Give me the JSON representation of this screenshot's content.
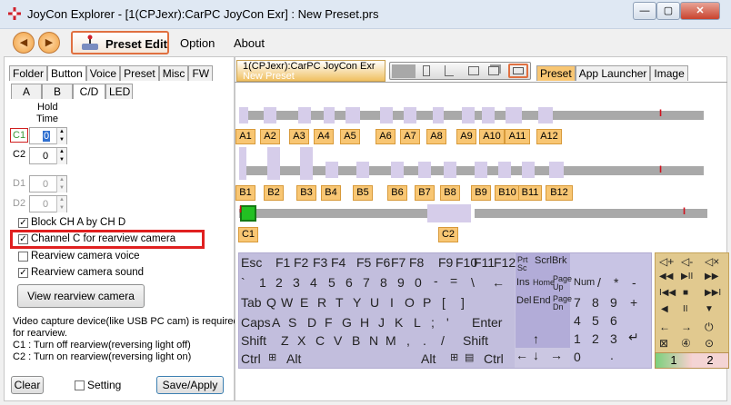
{
  "window": {
    "title": "JoyCon Explorer - [1(CPJexr):CarPC JoyCon Exr] : New Preset.prs",
    "min": "—",
    "max": "▢",
    "close": "✕"
  },
  "menu": {
    "back": "◀",
    "forward": "▶",
    "preset_edit": "Preset Edit",
    "option": "Option",
    "about": "About"
  },
  "left": {
    "tabs": [
      "Folder",
      "Button",
      "Voice",
      "Preset",
      "Misc",
      "FW"
    ],
    "subtabs": [
      "A",
      "B",
      "C/D",
      "LED"
    ],
    "hold_time": [
      "Hold",
      "Time"
    ],
    "rows": [
      {
        "label": "C1",
        "value": "0"
      },
      {
        "label": "C2",
        "value": "0"
      },
      {
        "label": "D1",
        "value": "0"
      },
      {
        "label": "D2",
        "value": "0"
      }
    ],
    "checks": [
      {
        "label": "Block CH A by CH D",
        "checked": true
      },
      {
        "label": "Channel C for rearview camera",
        "checked": true
      },
      {
        "label": "Rearview camera voice",
        "checked": false
      },
      {
        "label": "Rearview camera sound",
        "checked": true
      }
    ],
    "view_button": "View rearview camera",
    "info": [
      "Video capture device(like USB PC cam) is required",
      "for rearview.",
      "C1 : Turn off rearview(reversing light off)",
      "C2 : Turn on rearview(reversing light on)"
    ],
    "clear": "Clear",
    "setting": "Setting",
    "save": "Save/Apply"
  },
  "right": {
    "device_tab": "1(CPJexr):CarPC JoyCon Exr",
    "device_sub": "New Preset",
    "view_tabs": [
      "Preset",
      "App Launcher",
      "Image"
    ],
    "a_channels": [
      "A1",
      "A2",
      "A3",
      "A4",
      "A5",
      "A6",
      "A7",
      "A8",
      "A9",
      "A10",
      "A11",
      "A12"
    ],
    "b_channels": [
      "B1",
      "B2",
      "B3",
      "B4",
      "B5",
      "B6",
      "B7",
      "B8",
      "B9",
      "B10",
      "B11",
      "B12"
    ],
    "c_channels": [
      "C1",
      "C2"
    ]
  },
  "keyboard": {
    "fn": [
      "Esc",
      "F1",
      "F2",
      "F3",
      "F4",
      "F5",
      "F6",
      "F7",
      "F8",
      "F9",
      "F10",
      "F11",
      "F12",
      "Prt",
      "Sc",
      "ScrlBrk"
    ],
    "num": [
      "`",
      "1",
      "2",
      "3",
      "4",
      "5",
      "6",
      "7",
      "8",
      "9",
      "0",
      "-",
      "=",
      "\\",
      "←"
    ],
    "qrow": [
      "Tab",
      "Q",
      "W",
      "E",
      "R",
      "T",
      "Y",
      "U",
      "I",
      "O",
      "P",
      "[",
      "]"
    ],
    "arow": [
      "Caps",
      "A",
      "S",
      "D",
      "F",
      "G",
      "H",
      "J",
      "K",
      "L",
      ";",
      "'",
      "Enter"
    ],
    "zrow": [
      "Shift",
      "Z",
      "X",
      "C",
      "V",
      "B",
      "N",
      "M",
      ",",
      ".",
      "/",
      "Shift"
    ],
    "brow": [
      "Ctrl",
      "Alt",
      "Alt",
      "Ctrl"
    ],
    "nav": [
      "Ins",
      "Home",
      "Page Up",
      "Del",
      "End",
      "Page Dn",
      "↑",
      "←",
      "↓",
      "→"
    ],
    "pad": [
      "Num",
      "/",
      "*",
      "-",
      "7",
      "8",
      "9",
      "+",
      "4",
      "5",
      "6",
      "1",
      "2",
      "3",
      "↵",
      "0",
      "."
    ]
  },
  "media": {
    "keys": [
      "◁+",
      "◁-",
      "◁×",
      "◀◀",
      "▶II",
      "▶▶",
      "I◀◀",
      "■",
      "▶▶I",
      "◀",
      "II",
      "▼",
      "←",
      "→",
      "⏻",
      "⊠",
      "④",
      "⊙"
    ],
    "tab1": "1",
    "tab2": "2"
  }
}
